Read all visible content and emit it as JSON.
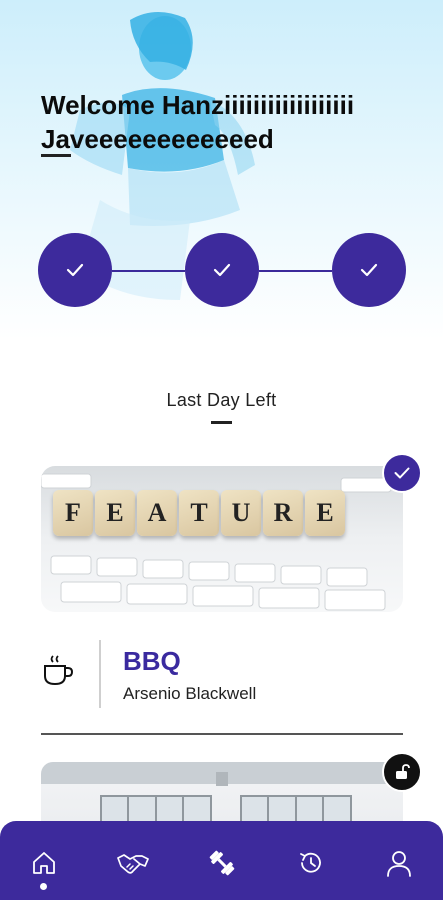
{
  "hero": {
    "welcome_line1": "Welcome Hanziiiiiiiiiiiiiiiiii",
    "welcome_line2": "Javeeeeeeeeeeeed"
  },
  "progress": {
    "steps": [
      {
        "icon": "check-icon",
        "completed": true
      },
      {
        "icon": "check-icon",
        "completed": true
      },
      {
        "icon": "check-icon",
        "completed": true
      }
    ]
  },
  "section": {
    "title": "Last Day Left"
  },
  "cards": [
    {
      "image_text": [
        "F",
        "E",
        "A",
        "T",
        "U",
        "R",
        "E"
      ],
      "badge_icon": "check-icon",
      "category_icon": "coffee-cup-icon",
      "title": "BBQ",
      "subtitle": "Arsenio Blackwell"
    },
    {
      "badge_icon": "unlock-icon"
    }
  ],
  "bottom_nav": {
    "items": [
      {
        "icon": "home-icon",
        "active": true
      },
      {
        "icon": "handshake-icon",
        "active": false
      },
      {
        "icon": "dumbbell-icon",
        "active": false
      },
      {
        "icon": "history-icon",
        "active": false
      },
      {
        "icon": "profile-icon",
        "active": false
      }
    ]
  },
  "colors": {
    "primary": "#3d2a9c",
    "title_accent": "#3a2a9f",
    "hero_tint": "#cdeefb"
  }
}
